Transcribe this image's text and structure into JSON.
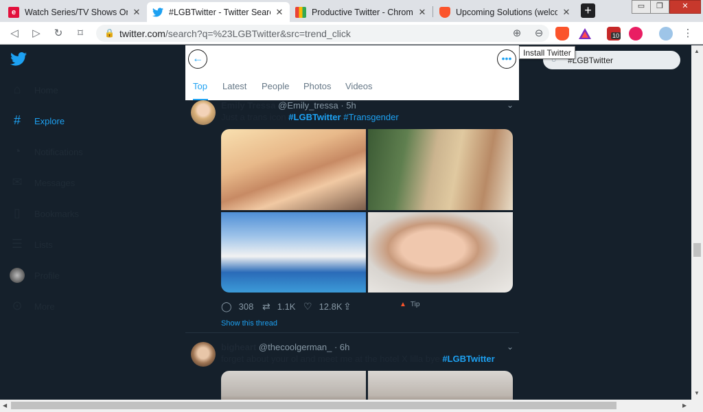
{
  "browser": {
    "tabs": [
      {
        "title": "Watch Series/TV Shows Onlin",
        "favicon": "e",
        "favicon_color": "#e2103c"
      },
      {
        "title": "#LGBTwitter - Twitter Search",
        "favicon": "twitter-bird",
        "favicon_color": "#1da1f2"
      },
      {
        "title": "Productive Twitter - Chrome",
        "favicon": "chrome-web-store",
        "favicon_color": "#4285f4"
      },
      {
        "title": "Upcoming Solutions (welcom",
        "favicon": "brave-lion",
        "favicon_color": "#fb542b"
      }
    ],
    "new_tab": "+",
    "url_host": "twitter.com",
    "url_path": "/search?q=%23LGBTwitter&src=trend_click",
    "ext_badge": "10",
    "tooltip": "Install Twitter"
  },
  "sidebar": {
    "items": [
      {
        "label": "Home",
        "icon": "home-icon"
      },
      {
        "label": "Explore",
        "icon": "hash-icon"
      },
      {
        "label": "Notifications",
        "icon": "bell-icon"
      },
      {
        "label": "Messages",
        "icon": "mail-icon"
      },
      {
        "label": "Bookmarks",
        "icon": "bookmark-icon"
      },
      {
        "label": "Lists",
        "icon": "list-icon"
      },
      {
        "label": "Profile",
        "icon": "avatar"
      },
      {
        "label": "More",
        "icon": "more-icon"
      }
    ],
    "active": "Explore"
  },
  "search": {
    "tabs": [
      "Top",
      "Latest",
      "People",
      "Photos",
      "Videos"
    ],
    "active_tab": "Top",
    "query": "#LGBTwitter"
  },
  "tweets": [
    {
      "name": "Emily Tressa",
      "handle": "@Emily_tressa",
      "time": "· 5h",
      "text": "Just a trans icon",
      "tags": [
        "#LGBTwitter",
        "#Transgender"
      ],
      "replies": "308",
      "retweets": "1.1K",
      "likes": "12.8K",
      "tip": "Tip",
      "show_thread": "Show this thread"
    },
    {
      "name": "bigheart",
      "handle": "@thecoolgerman_",
      "time": "· 6h",
      "text": "forget about your ol and meet me at the hotel X lilla bye",
      "tags": [
        "#LGBTwitter"
      ]
    }
  ],
  "colors": {
    "accent": "#1da1f2",
    "background": "#15202b",
    "secondary_text": "#8899a6"
  }
}
